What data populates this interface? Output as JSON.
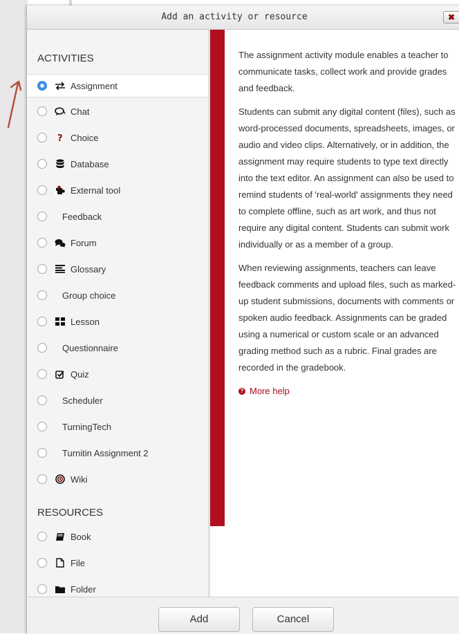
{
  "modal": {
    "title": "Add an activity or resource",
    "close_label": "✖"
  },
  "sections": {
    "activities": "ACTIVITIES",
    "resources": "RESOURCES"
  },
  "activities": [
    {
      "label": "Assignment",
      "icon": "assignment-arrows-icon",
      "selected": true
    },
    {
      "label": "Chat",
      "icon": "chat-icon"
    },
    {
      "label": "Choice",
      "icon": "question-mark-icon"
    },
    {
      "label": "Database",
      "icon": "database-icon"
    },
    {
      "label": "External tool",
      "icon": "puzzle-icon"
    },
    {
      "label": "Feedback",
      "icon": "none"
    },
    {
      "label": "Forum",
      "icon": "forum-icon"
    },
    {
      "label": "Glossary",
      "icon": "list-icon"
    },
    {
      "label": "Group choice",
      "icon": "none"
    },
    {
      "label": "Lesson",
      "icon": "grid-icon"
    },
    {
      "label": "Questionnaire",
      "icon": "none"
    },
    {
      "label": "Quiz",
      "icon": "checkbox-icon"
    },
    {
      "label": "Scheduler",
      "icon": "none"
    },
    {
      "label": "TurningTech",
      "icon": "none"
    },
    {
      "label": "Turnitin Assignment 2",
      "icon": "none"
    },
    {
      "label": "Wiki",
      "icon": "target-icon"
    }
  ],
  "resources": [
    {
      "label": "Book",
      "icon": "book-icon"
    },
    {
      "label": "File",
      "icon": "file-icon"
    },
    {
      "label": "Folder",
      "icon": "folder-icon"
    }
  ],
  "help": {
    "paragraphs": [
      "The assignment activity module enables a teacher to communicate tasks, collect work and provide grades and feedback.",
      "Students can submit any digital content (files), such as word-processed documents, spreadsheets, images, or audio and video clips. Alternatively, or in addition, the assignment may require students to type text directly into the text editor. An assignment can also be used to remind students of 'real-world' assignments they need to complete offline, such as art work, and thus not require any digital content. Students can submit work individually or as a member of a group.",
      "When reviewing assignments, teachers can leave feedback comments and upload files, such as marked-up student submissions, documents with comments or spoken audio feedback. Assignments can be graded using a numerical or custom scale or an advanced grading method such as a rubric. Final grades are recorded in the gradebook."
    ],
    "more_help": "More help"
  },
  "footer": {
    "add_label": "Add",
    "cancel_label": "Cancel"
  },
  "colors": {
    "accent_red": "#b00f1d",
    "link_red": "#a30f1a",
    "radio_blue": "#3f8fe8"
  }
}
